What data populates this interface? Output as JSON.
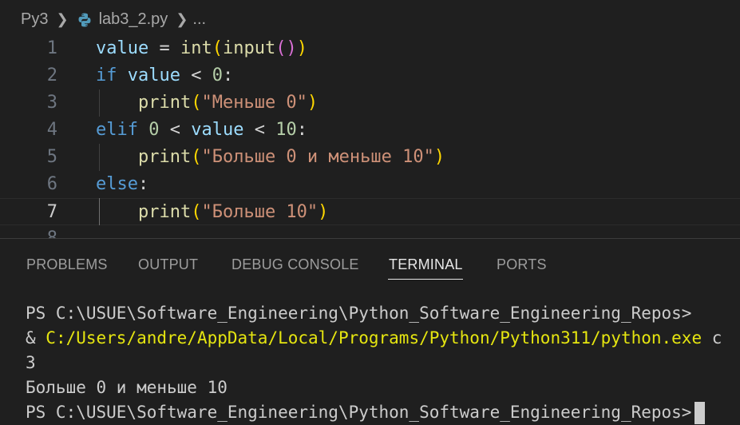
{
  "breadcrumb": {
    "folder": "Py3",
    "file": "lab3_2.py",
    "more": "..."
  },
  "editor": {
    "active_line": 7,
    "lines": [
      {
        "num": "1",
        "tokens": [
          {
            "t": "value",
            "c": "var"
          },
          {
            "t": " = ",
            "c": "op"
          },
          {
            "t": "int",
            "c": "fn"
          },
          {
            "t": "(",
            "c": "p1"
          },
          {
            "t": "input",
            "c": "fn"
          },
          {
            "t": "()",
            "c": "p2"
          },
          {
            "t": ")",
            "c": "p1"
          }
        ]
      },
      {
        "num": "2",
        "tokens": [
          {
            "t": "if",
            "c": "kw"
          },
          {
            "t": " ",
            "c": "op"
          },
          {
            "t": "value",
            "c": "var"
          },
          {
            "t": " < ",
            "c": "op"
          },
          {
            "t": "0",
            "c": "num"
          },
          {
            "t": ":",
            "c": "op"
          }
        ]
      },
      {
        "num": "3",
        "tokens": [
          {
            "t": "    ",
            "c": "op"
          },
          {
            "t": "print",
            "c": "fn"
          },
          {
            "t": "(",
            "c": "p1"
          },
          {
            "t": "\"Меньше 0\"",
            "c": "str"
          },
          {
            "t": ")",
            "c": "p1"
          }
        ]
      },
      {
        "num": "4",
        "tokens": [
          {
            "t": "elif",
            "c": "kw"
          },
          {
            "t": " ",
            "c": "op"
          },
          {
            "t": "0",
            "c": "num"
          },
          {
            "t": " < ",
            "c": "op"
          },
          {
            "t": "value",
            "c": "var"
          },
          {
            "t": " < ",
            "c": "op"
          },
          {
            "t": "10",
            "c": "num"
          },
          {
            "t": ":",
            "c": "op"
          }
        ]
      },
      {
        "num": "5",
        "tokens": [
          {
            "t": "    ",
            "c": "op"
          },
          {
            "t": "print",
            "c": "fn"
          },
          {
            "t": "(",
            "c": "p1"
          },
          {
            "t": "\"Больше 0 и меньше 10\"",
            "c": "str"
          },
          {
            "t": ")",
            "c": "p1"
          }
        ]
      },
      {
        "num": "6",
        "tokens": [
          {
            "t": "else",
            "c": "kw"
          },
          {
            "t": ":",
            "c": "op"
          }
        ]
      },
      {
        "num": "7",
        "tokens": [
          {
            "t": "    ",
            "c": "op"
          },
          {
            "t": "print",
            "c": "fn"
          },
          {
            "t": "(",
            "c": "p1"
          },
          {
            "t": "\"Больше 10\"",
            "c": "str"
          },
          {
            "t": ")",
            "c": "p1"
          }
        ]
      },
      {
        "num": "8",
        "tokens": []
      }
    ]
  },
  "panel": {
    "tabs": [
      {
        "label": "PROBLEMS",
        "active": false
      },
      {
        "label": "OUTPUT",
        "active": false
      },
      {
        "label": "DEBUG CONSOLE",
        "active": false
      },
      {
        "label": "TERMINAL",
        "active": true
      },
      {
        "label": "PORTS",
        "active": false
      }
    ]
  },
  "terminal": {
    "line1": "PS C:\\USUE\\Software_Engineering\\Python_Software_Engineering_Repos>",
    "line2_prefix": "& ",
    "line2_path": "C:/Users/andre/AppData/Local/Programs/Python/Python311/python.exe",
    "line2_suffix": " c",
    "line3": "3",
    "line4": "Больше 0 и меньше 10",
    "line5": "PS C:\\USUE\\Software_Engineering\\Python_Software_Engineering_Repos>"
  },
  "colors": {
    "background": "#1f1f1f",
    "keyword": "#569cd6",
    "variable": "#9cdcfe",
    "function": "#dcdcaa",
    "string": "#ce9178",
    "number": "#b5cea8",
    "terminal_path": "#e5e510"
  }
}
